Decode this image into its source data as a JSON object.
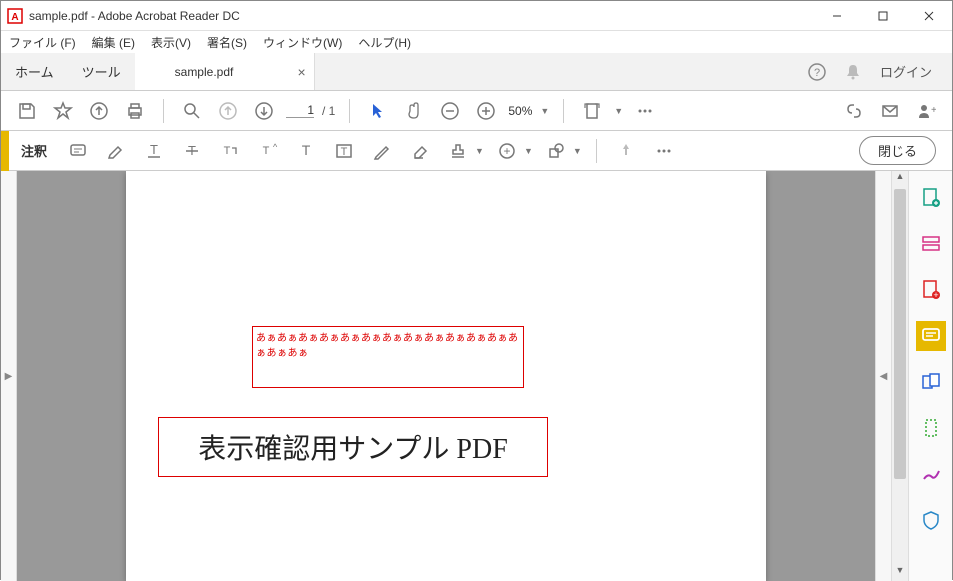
{
  "window": {
    "title": "sample.pdf - Adobe Acrobat Reader DC"
  },
  "menubar": {
    "file": "ファイル (F)",
    "edit": "編集 (E)",
    "view": "表示(V)",
    "sign": "署名(S)",
    "window": "ウィンドウ(W)",
    "help": "ヘルプ(H)"
  },
  "tabbar": {
    "home": "ホーム",
    "tools": "ツール",
    "doc": "sample.pdf",
    "login": "ログイン"
  },
  "toolbar1": {
    "page_current": "1",
    "page_total": "/ 1",
    "zoom": "50%"
  },
  "toolbar2": {
    "label": "注釈",
    "close": "閉じる"
  },
  "document": {
    "annotation_text": "あぁあぁあぁあぁあぁあぁあぁあぁあぁあぁあぁあぁあぁあぁあぁ",
    "main_text": "表示確認用サンプル PDF"
  }
}
